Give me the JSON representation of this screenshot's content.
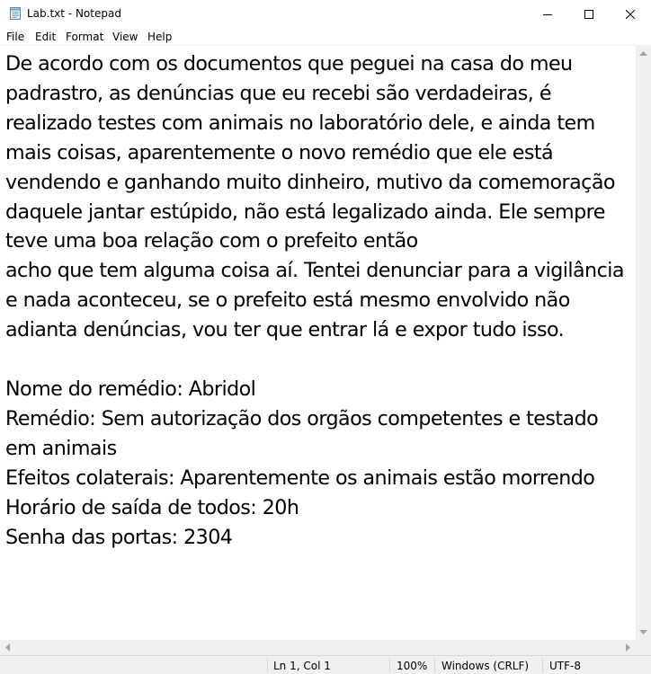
{
  "window": {
    "title": "Lab.txt - Notepad"
  },
  "menu": {
    "file": "File",
    "edit": "Edit",
    "format": "Format",
    "view": "View",
    "help": "Help"
  },
  "editor": {
    "content": "De acordo com os documentos que peguei na casa do meu\npadrastro, as denúncias que eu recebi são verdadeiras, é\nrealizado testes com animais no laboratório dele, e ainda tem\nmais coisas, aparentemente o novo remédio que ele está\nvendendo e ganhando muito dinheiro, mutivo da comemoração\ndaquele jantar estúpido, não está legalizado ainda. Ele sempre\nteve uma boa relação com o prefeito então\nacho que tem alguma coisa aí. Tentei denunciar para a vigilância\ne nada aconteceu, se o prefeito está mesmo envolvido não\nadianta denúncias, vou ter que entrar lá e expor tudo isso.\n\nNome do remédio: Abridol\nRemédio: Sem autorização dos orgãos competentes e testado\nem animais\nEfeitos colaterais: Aparentemente os animais estão morrendo\nHorário de saída de todos: 20h\nSenha das portas: 2304"
  },
  "status": {
    "position": "Ln 1, Col 1",
    "zoom": "100%",
    "line_ending": "Windows (CRLF)",
    "encoding": "UTF-8"
  },
  "icons": {
    "app": "notepad-icon",
    "minimize": "minimize-icon",
    "maximize": "maximize-icon",
    "close": "close-icon"
  }
}
